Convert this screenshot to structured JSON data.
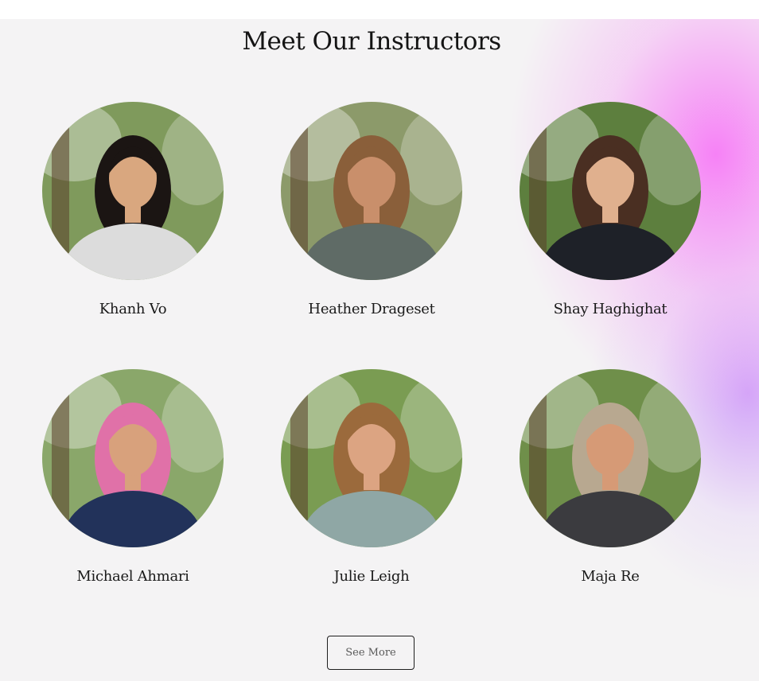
{
  "section": {
    "title": "Meet Our Instructors"
  },
  "instructors": [
    {
      "name": "Khanh Vo",
      "photo_icon": "instructor-photo",
      "bg": "#7f9a5c",
      "skin": "#d9a77f",
      "hair": "#1b1513",
      "shirt": "#dcdcdc"
    },
    {
      "name": "Heather Drageset",
      "photo_icon": "instructor-photo",
      "bg": "#8c9a6a",
      "skin": "#c98f6b",
      "hair": "#8a5f3a",
      "shirt": "#5f6b66"
    },
    {
      "name": "Shay Haghighat",
      "photo_icon": "instructor-photo",
      "bg": "#5d7f3e",
      "skin": "#e0b08e",
      "hair": "#4a2f22",
      "shirt": "#1e2128"
    },
    {
      "name": "Michael Ahmari",
      "photo_icon": "instructor-photo",
      "bg": "#8aa76a",
      "skin": "#d8a17c",
      "hair": "#e071a8",
      "shirt": "#22325a"
    },
    {
      "name": "Julie Leigh",
      "photo_icon": "instructor-photo",
      "bg": "#7a9c52",
      "skin": "#dca482",
      "hair": "#9b6a3c",
      "shirt": "#8fa7a5"
    },
    {
      "name": "Maja Re",
      "photo_icon": "instructor-photo",
      "bg": "#6f8f4a",
      "skin": "#d69a76",
      "hair": "#b8a890",
      "shirt": "#3b3b3f"
    }
  ],
  "cta": {
    "see_more_label": "See More"
  }
}
